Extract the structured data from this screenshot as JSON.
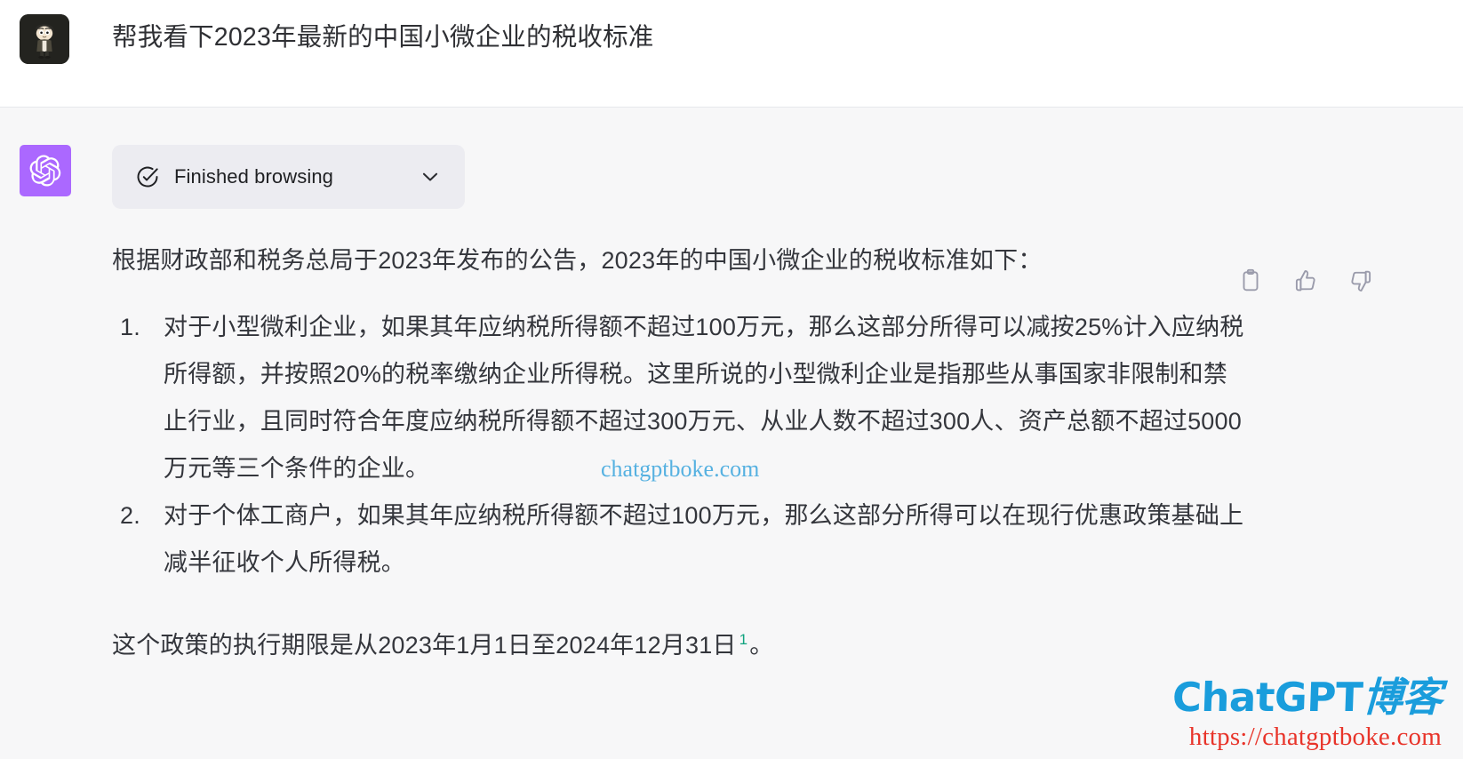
{
  "user": {
    "avatar_alt": "cartoon-boy-avatar",
    "message": "帮我看下2023年最新的中国小微企业的税收标准"
  },
  "assistant": {
    "avatar_alt": "openai-logo",
    "browsing": {
      "status_label": "Finished browsing",
      "check_icon": "check-circle-icon",
      "expand_icon": "chevron-down-icon"
    },
    "actions": [
      {
        "name": "copy-icon",
        "label": "Copy"
      },
      {
        "name": "thumbs-up-icon",
        "label": "Good response"
      },
      {
        "name": "thumbs-down-icon",
        "label": "Bad response"
      }
    ],
    "lead": "根据财政部和税务总局于2023年发布的公告，2023年的中国小微企业的税收标准如下：",
    "list": [
      "对于小型微利企业，如果其年应纳税所得额不超过100万元，那么这部分所得可以减按25%计入应纳税所得额，并按照20%的税率缴纳企业所得税。这里所说的小型微利企业是指那些从事国家非限制和禁止行业，且同时符合年度应纳税所得额不超过300万元、从业人数不超过300人、资产总额不超过5000万元等三个条件的企业。",
      "对于个体工商户，如果其年应纳税所得额不超过100万元，那么这部分所得可以在现行优惠政策基础上减半征收个人所得税。"
    ],
    "tail_prefix": "这个政策的执行期限是从2023年1月1日至2024年12月31日",
    "tail_footnote": "1",
    "tail_suffix": "。"
  },
  "watermarks": {
    "inline_text": "chatgptboke.com",
    "logo_brand_en": "ChatGPT",
    "logo_brand_cn": "博客",
    "logo_url": "https://chatgptboke.com"
  },
  "colors": {
    "assistant_bg": "#f7f7f8",
    "avatar_bot_bg": "#ab68ff",
    "chip_bg": "#ececf1",
    "footnote": "#10a37f",
    "watermark_blue": "#1a9ddc",
    "watermark_red": "#e8342a",
    "inline_watermark": "#3aa5dd"
  }
}
